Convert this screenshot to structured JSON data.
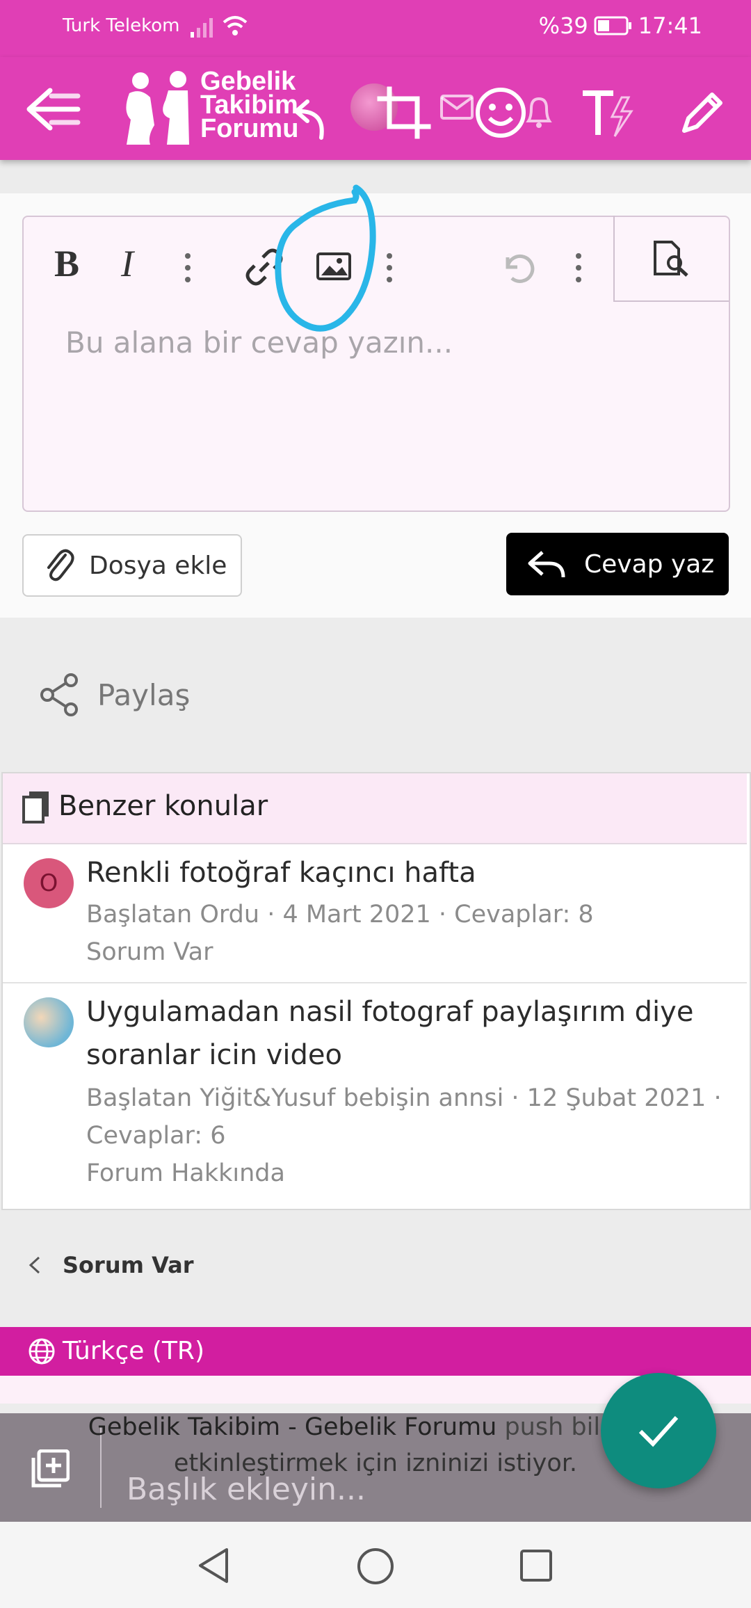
{
  "status": {
    "carrier": "Turk Telekom",
    "battery": "%39",
    "time": "17:41"
  },
  "header": {
    "logo_lines": [
      "Gebelik",
      "Takibim",
      "Forumu"
    ]
  },
  "editor": {
    "placeholder": "Bu alana bir cevap yazın..."
  },
  "actions": {
    "attach_label": "Dosya ekle",
    "reply_label": "Cevap yaz"
  },
  "share": {
    "label": "Paylaş"
  },
  "similar": {
    "heading": "Benzer konular",
    "threads": [
      {
        "avatar_letter": "O",
        "title": "Renkli fotoğraf kaçıncı hafta",
        "meta": "Başlatan Ordu · 4 Mart 2021 · Cevaplar: 8",
        "forum": "Sorum Var"
      },
      {
        "title_line1": "Uygulamadan nasil fotograf paylaşırım diye",
        "title_line2": "soranlar icin video",
        "meta_line1": "Başlatan Yiğit&Yusuf bebişin annsi · 12 Şubat 2021 ·",
        "meta_line2": "Cevaplar: 6",
        "forum": "Forum Hakkında"
      }
    ]
  },
  "breadcrumb": {
    "label": "Sorum Var"
  },
  "language": {
    "label": "Türkçe (TR)"
  },
  "push": {
    "line1_site": "Gebelik Takibim - Gebelik Forumu",
    "line1_rest": " push bildirim",
    "line2": "etkinleştirmek için izninizi istiyor."
  },
  "title_input": {
    "placeholder": "Başlık ekleyin..."
  },
  "colors": {
    "brand": "#e03fb5",
    "lang_bar": "#d21ea0",
    "fab": "#0e8c7e",
    "annotation": "#29b6e8"
  }
}
